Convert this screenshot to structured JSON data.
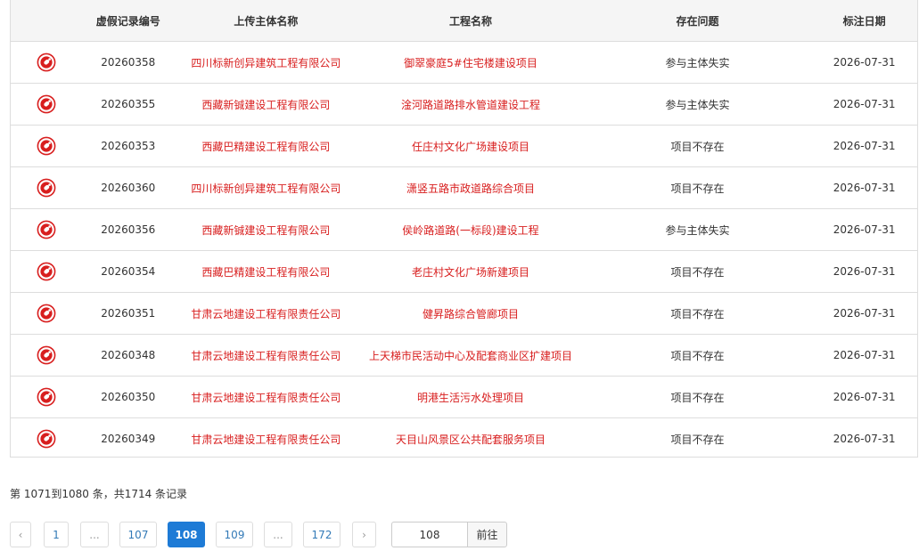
{
  "colors": {
    "accent_red": "#d81e1e",
    "active_blue": "#1e7bd6"
  },
  "table": {
    "headers": [
      "",
      "虚假记录编号",
      "上传主体名称",
      "工程名称",
      "存在问题",
      "标注日期"
    ],
    "rows": [
      {
        "icon": "badge-icon",
        "id": "20260358",
        "company": "四川标新创异建筑工程有限公司",
        "project": "御翠豪庭5#住宅楼建设项目",
        "issue": "参与主体失实",
        "date": "2026-07-31"
      },
      {
        "icon": "badge-icon",
        "id": "20260355",
        "company": "西藏新铖建设工程有限公司",
        "project": "淦河路道路排水管道建设工程",
        "issue": "参与主体失实",
        "date": "2026-07-31"
      },
      {
        "icon": "badge-icon",
        "id": "20260353",
        "company": "西藏巴精建设工程有限公司",
        "project": "任庄村文化广场建设项目",
        "issue": "项目不存在",
        "date": "2026-07-31"
      },
      {
        "icon": "badge-icon",
        "id": "20260360",
        "company": "四川标新创异建筑工程有限公司",
        "project": "潇竖五路市政道路综合项目",
        "issue": "项目不存在",
        "date": "2026-07-31"
      },
      {
        "icon": "badge-icon",
        "id": "20260356",
        "company": "西藏新铖建设工程有限公司",
        "project": "侯岭路道路(一标段)建设工程",
        "issue": "参与主体失实",
        "date": "2026-07-31"
      },
      {
        "icon": "badge-icon",
        "id": "20260354",
        "company": "西藏巴精建设工程有限公司",
        "project": "老庄村文化广场新建项目",
        "issue": "项目不存在",
        "date": "2026-07-31"
      },
      {
        "icon": "badge-icon",
        "id": "20260351",
        "company": "甘肃云地建设工程有限责任公司",
        "project": "健昇路综合管廊项目",
        "issue": "项目不存在",
        "date": "2026-07-31"
      },
      {
        "icon": "badge-icon",
        "id": "20260348",
        "company": "甘肃云地建设工程有限责任公司",
        "project": "上天梯市民活动中心及配套商业区扩建项目",
        "issue": "项目不存在",
        "date": "2026-07-31"
      },
      {
        "icon": "badge-icon",
        "id": "20260350",
        "company": "甘肃云地建设工程有限责任公司",
        "project": "明港生活污水处理项目",
        "issue": "项目不存在",
        "date": "2026-07-31"
      },
      {
        "icon": "badge-icon",
        "id": "20260349",
        "company": "甘肃云地建设工程有限责任公司",
        "project": "天目山风景区公共配套服务项目",
        "issue": "项目不存在",
        "date": "2026-07-31"
      }
    ]
  },
  "summary": "第 1071到1080 条，共1714 条记录",
  "pagination": {
    "prev": "‹",
    "pages": [
      "1",
      "...",
      "107",
      "108",
      "109",
      "...",
      "172"
    ],
    "active": "108",
    "next": "›",
    "jump_value": "108",
    "jump_label": "前往"
  }
}
